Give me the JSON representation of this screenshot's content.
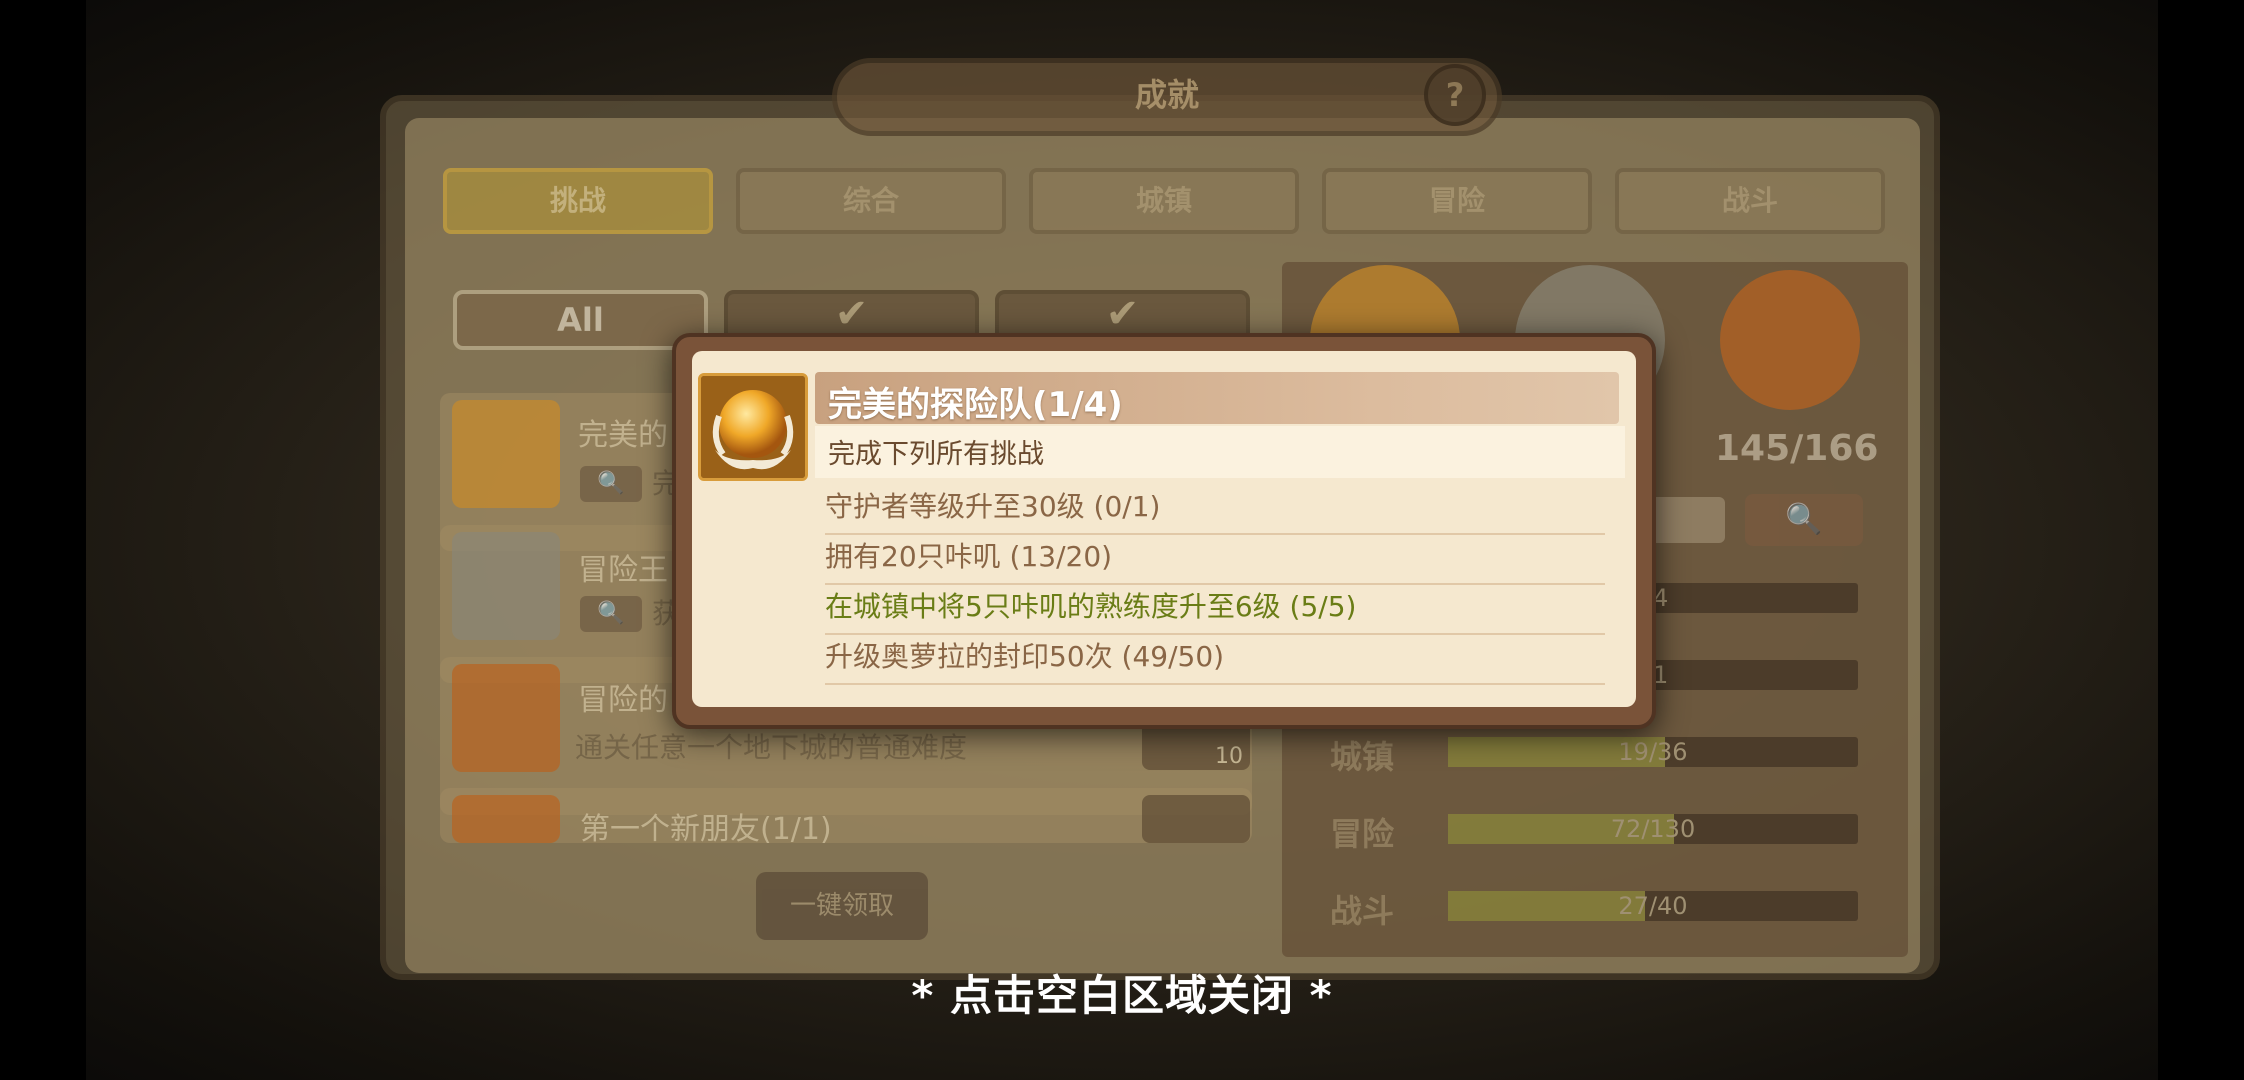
{
  "window": {
    "title": "成就",
    "help_glyph": "?"
  },
  "tabs": [
    {
      "label": "挑战",
      "active": true
    },
    {
      "label": "综合",
      "active": false
    },
    {
      "label": "城镇",
      "active": false
    },
    {
      "label": "冒险",
      "active": false
    },
    {
      "label": "战斗",
      "active": false
    }
  ],
  "filters": {
    "all_label": "All",
    "check_glyph": "✔"
  },
  "list": [
    {
      "title": "完美的",
      "desc": "完",
      "icon_color": "#e2a232"
    },
    {
      "title": "冒险王",
      "desc": "获",
      "icon_color": "#9a9a8a"
    },
    {
      "title": "冒险的",
      "desc": "通关任意一个地下城的普通难度",
      "icon_color": "#d4782a",
      "reward": "10"
    },
    {
      "title": "第一个新朋友(1/1)",
      "desc": "",
      "icon_color": "#d4782a"
    }
  ],
  "claim_all": "一键领取",
  "search_glyph": "🔍",
  "score": "145/166",
  "stats": [
    {
      "label": "",
      "value": "24",
      "fraction": 0.0
    },
    {
      "label": "",
      "value": "11",
      "fraction": 0.0
    },
    {
      "label": "城镇",
      "value": "19/36",
      "fraction": 0.53
    },
    {
      "label": "冒险",
      "value": "72/130",
      "fraction": 0.55
    },
    {
      "label": "战斗",
      "value": "27/40",
      "fraction": 0.48
    }
  ],
  "popup": {
    "title": "完美的探险队(1/4)",
    "subtitle": "完成下列所有挑战",
    "requirements": [
      {
        "text": "守护者等级升至30级 (0/1)",
        "done": false
      },
      {
        "text": "拥有20只咔叽 (13/20)",
        "done": false
      },
      {
        "text": "在城镇中将5只咔叽的熟练度升至6级 (5/5)",
        "done": true
      },
      {
        "text": "升级奥萝拉的封印50次 (49/50)",
        "done": false
      }
    ]
  },
  "hint": "* 点击空白区域关闭 *",
  "colors": {
    "done": "#6a7d16",
    "pending": "#8a6646",
    "popup_frame": "#7a5339"
  }
}
